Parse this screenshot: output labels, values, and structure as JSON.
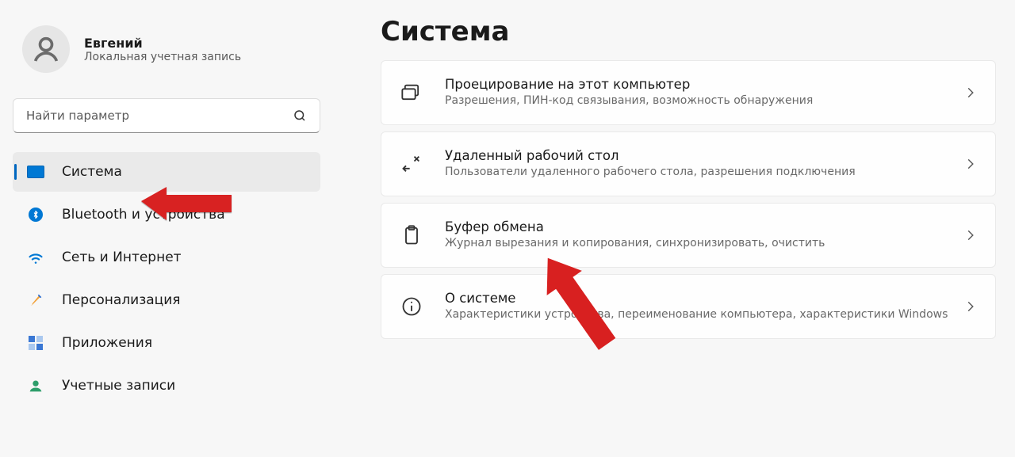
{
  "user": {
    "name": "Евгений",
    "subtitle": "Локальная учетная запись"
  },
  "search": {
    "placeholder": "Найти параметр"
  },
  "sidebar": {
    "items": [
      {
        "label": "Система",
        "active": true
      },
      {
        "label": "Bluetooth и устройства",
        "active": false
      },
      {
        "label": "Сеть и Интернет",
        "active": false
      },
      {
        "label": "Персонализация",
        "active": false
      },
      {
        "label": "Приложения",
        "active": false
      },
      {
        "label": "Учетные записи",
        "active": false
      }
    ]
  },
  "page": {
    "title": "Система"
  },
  "cards": [
    {
      "title": "Проецирование на этот компьютер",
      "subtitle": "Разрешения, ПИН-код связывания, возможность обнаружения"
    },
    {
      "title": "Удаленный рабочий стол",
      "subtitle": "Пользователи удаленного рабочего стола, разрешения подключения"
    },
    {
      "title": "Буфер обмена",
      "subtitle": "Журнал вырезания и копирования, синхронизировать, очистить"
    },
    {
      "title": "О системе",
      "subtitle": "Характеристики устройства, переименование компьютера, характеристики Windows"
    }
  ]
}
